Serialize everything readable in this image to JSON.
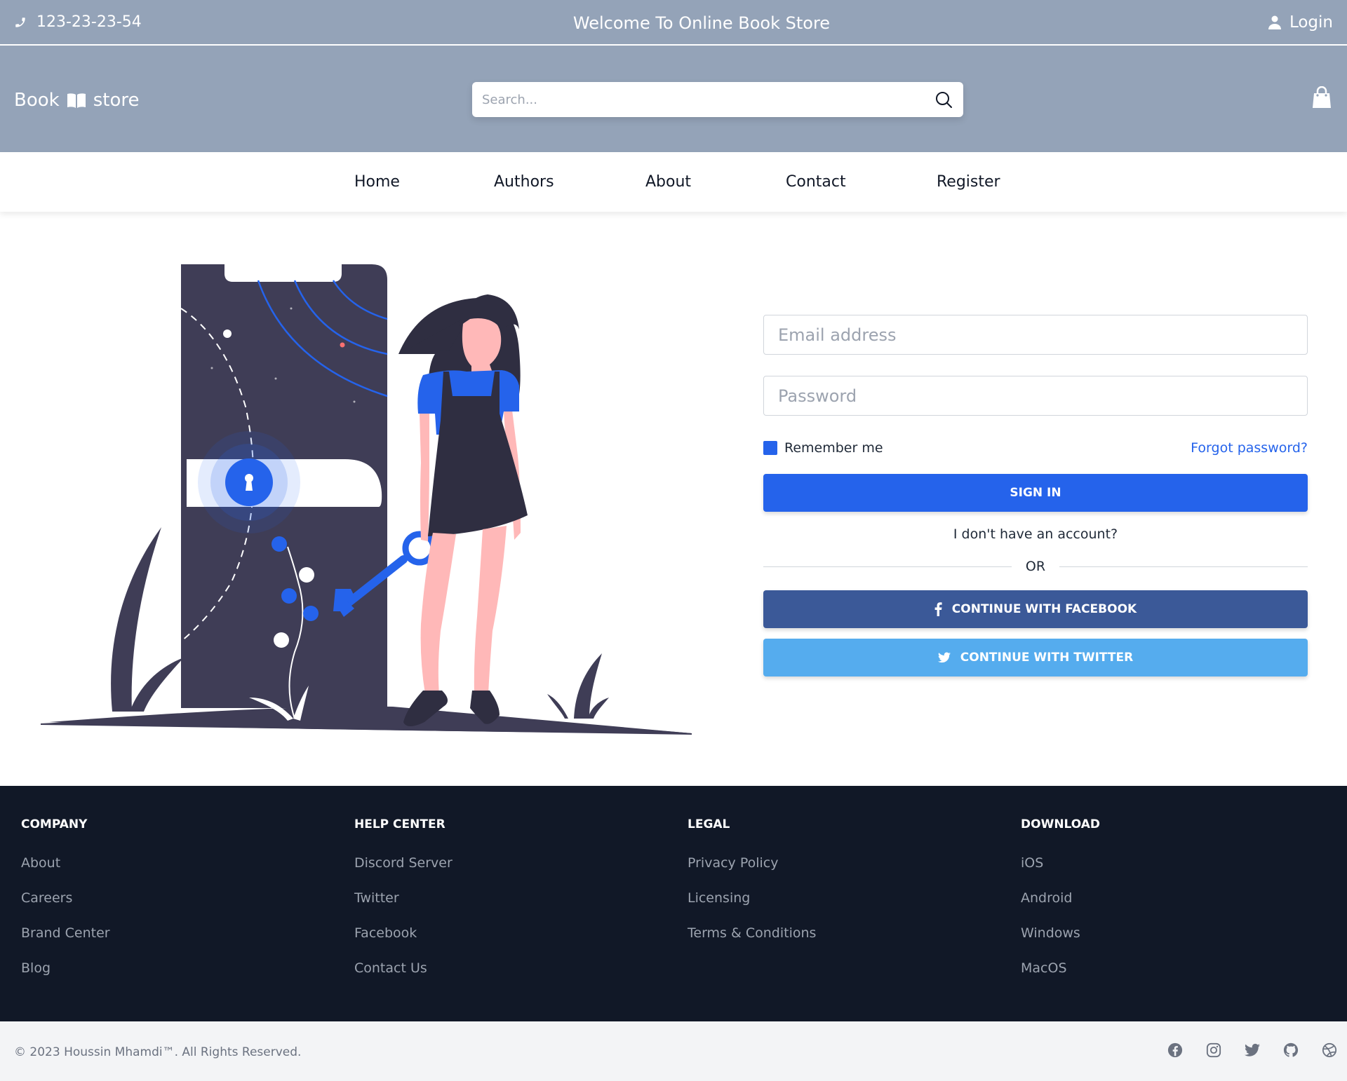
{
  "topbar": {
    "phone": "123-23-23-54",
    "welcome": "Welcome To Online Book Store",
    "login": "Login"
  },
  "header": {
    "logo_left": "Book",
    "logo_right": "store",
    "search_placeholder": "Search..."
  },
  "nav": {
    "items": [
      {
        "label": "Home"
      },
      {
        "label": "Authors"
      },
      {
        "label": "About"
      },
      {
        "label": "Contact"
      },
      {
        "label": "Register"
      }
    ]
  },
  "login_form": {
    "email_placeholder": "Email address",
    "password_placeholder": "Password",
    "remember_label": "Remember me",
    "forgot_label": "Forgot password?",
    "signin_label": "SIGN IN",
    "no_account": "I don't have an account?",
    "or_label": "OR",
    "facebook_label": "CONTINUE WITH FACEBOOK",
    "twitter_label": "CONTINUE WITH TWITTER"
  },
  "footer": {
    "columns": [
      {
        "title": "COMPANY",
        "links": [
          "About",
          "Careers",
          "Brand Center",
          "Blog"
        ]
      },
      {
        "title": "HELP CENTER",
        "links": [
          "Discord Server",
          "Twitter",
          "Facebook",
          "Contact Us"
        ]
      },
      {
        "title": "LEGAL",
        "links": [
          "Privacy Policy",
          "Licensing",
          "Terms & Conditions"
        ]
      },
      {
        "title": "DOWNLOAD",
        "links": [
          "iOS",
          "Android",
          "Windows",
          "MacOS"
        ]
      }
    ],
    "copyright": "© 2023 Houssin Mhamdi™. All Rights Reserved.",
    "social_icons": [
      "facebook-icon",
      "instagram-icon",
      "twitter-icon",
      "github-icon",
      "dribbble-icon"
    ]
  },
  "colors": {
    "header_bg": "#94a3b8",
    "primary": "#2563eb",
    "facebook": "#3b5998",
    "twitter": "#55acee",
    "footer_bg": "#111827",
    "illustration_dark": "#3f3d56"
  }
}
